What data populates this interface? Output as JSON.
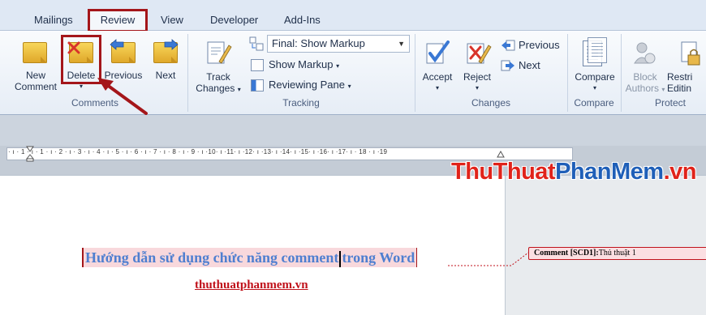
{
  "tabs": {
    "mailings": "Mailings",
    "review": "Review",
    "view": "View",
    "developer": "Developer",
    "addins": "Add-Ins"
  },
  "ribbon": {
    "comments": {
      "new_line1": "New",
      "new_line2": "Comment",
      "delete": "Delete",
      "previous": "Previous",
      "next": "Next",
      "group_label": "Comments"
    },
    "tracking": {
      "track_line1": "Track",
      "track_line2": "Changes",
      "markup_dropdown": "Final: Show Markup",
      "show_markup": "Show Markup",
      "reviewing_pane": "Reviewing Pane",
      "group_label": "Tracking"
    },
    "changes": {
      "accept": "Accept",
      "reject": "Reject",
      "previous": "Previous",
      "next": "Next",
      "group_label": "Changes"
    },
    "compare": {
      "compare": "Compare",
      "group_label": "Compare"
    },
    "protect": {
      "block_line1": "Block",
      "block_line2": "Authors",
      "restrict_line1": "Restri",
      "restrict_line2": "Editin",
      "group_label": "Protect"
    }
  },
  "ruler": {
    "numbers": "· ı · 1 · ı · 1 · ı · 2 · ı · 3 · ı · 4 · ı · 5 · ı · 6 · ı · 7 · ı · 8 · ı · 9 · ı ·10· ı ·11· ı ·12· ı ·13· ı ·14· ı ·15· ı ·16· ı ·17· ı · 18 · ı ·19"
  },
  "document": {
    "heading_part1": "Hướng dẫn sử dụng chức năng comment",
    "heading_part2": "trong Word",
    "link": "thuthuatphanmem.vn"
  },
  "comment": {
    "label": "Comment [SCD1]:",
    "text": "Thủ thuật 1"
  },
  "watermark": {
    "part1": "ThuThuat",
    "part2": "PhanMem",
    "part3": ".vn"
  },
  "colors": {
    "highlight_red": "#a4161a",
    "heading_blue": "#4f7fd0",
    "link_red": "#c0121b"
  }
}
